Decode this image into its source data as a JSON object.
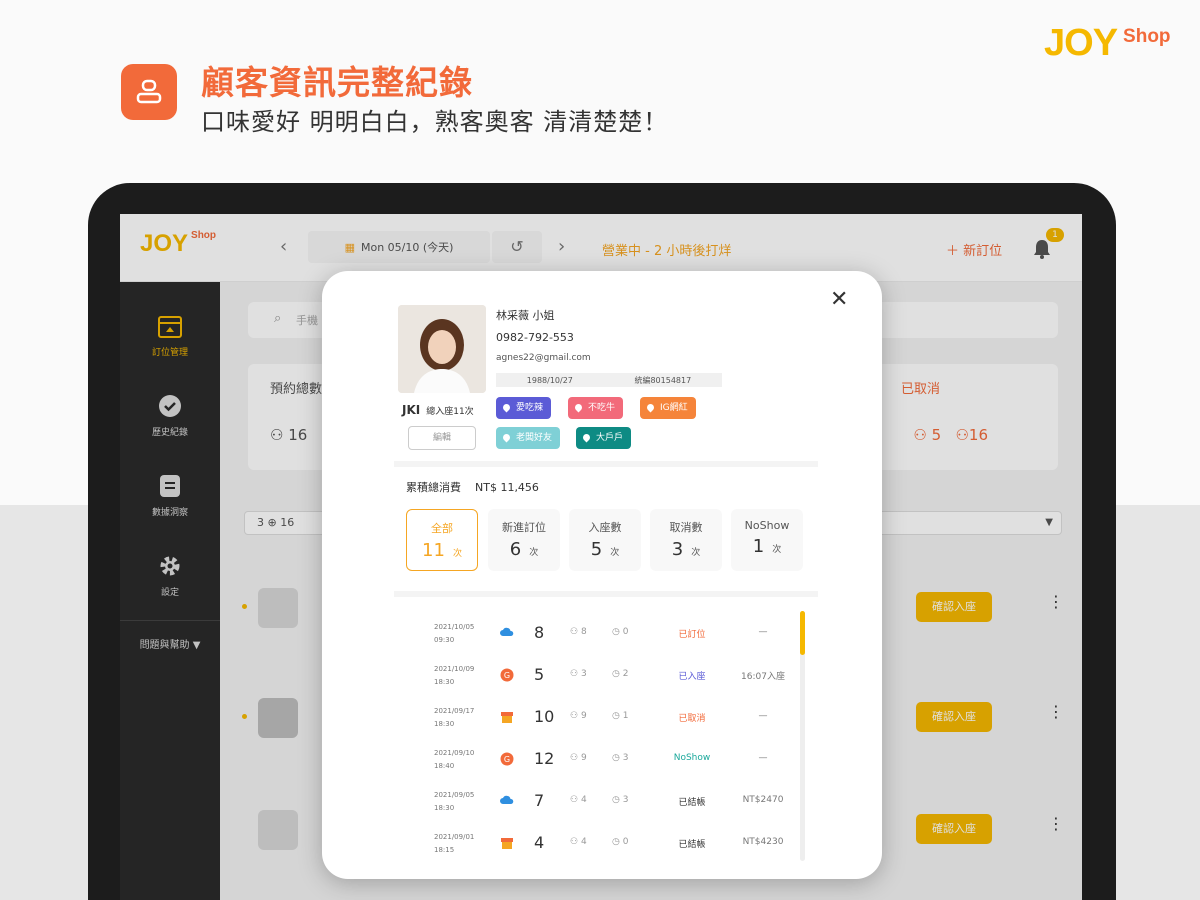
{
  "colors": {
    "accent": "#f26a3a",
    "brand_yellow": "#f5b800",
    "warn": "#f5a623"
  },
  "promo": {
    "title": "顧客資訊完整紀錄",
    "subtitle": "口味愛好 明明白白，熟客奧客 清清楚楚！"
  },
  "brand": {
    "joy": "JOY",
    "shop": "Shop"
  },
  "topbar": {
    "logo_joy": "JOY",
    "logo_shop": "Shop",
    "date": "Mon 05/10 (今天)",
    "status": "營業中 - 2 小時後打烊",
    "add_label": "新訂位",
    "bell_badge": "1"
  },
  "sidebar": {
    "items": [
      {
        "label": "訂位管理",
        "icon": "calendar-icon"
      },
      {
        "label": "歷史紀錄",
        "icon": "check-circle-icon"
      },
      {
        "label": "數據洞察",
        "icon": "list-icon"
      },
      {
        "label": "設定",
        "icon": "gear-icon"
      }
    ],
    "help": "問題與幫助"
  },
  "main": {
    "search_placeholder": "手機",
    "summary": {
      "left_label": "預約總數",
      "left_counts": "16",
      "right_label": "已取消",
      "right_counts": "5",
      "right_counts2": "16"
    },
    "filter": {
      "text": "3 ⊕ 16"
    },
    "rows": [
      {
        "action": "確認入座"
      },
      {
        "action": "確認入座"
      },
      {
        "action": "確認入座"
      }
    ]
  },
  "customer": {
    "name": "林采薇 小姐",
    "phone": "0982-792-553",
    "email": "agnes22@gmail.com",
    "birthday": "1988/10/27",
    "member_no": "統編80154817",
    "visit_count": "總入座11次",
    "visit_badge": "JKI",
    "edit_label": "編輯",
    "tags": [
      {
        "label": "愛吃辣",
        "color": "#5b5bd6"
      },
      {
        "label": "不吃牛",
        "color": "#f26a7a"
      },
      {
        "label": "IG網紅",
        "color": "#f5843a"
      },
      {
        "label": "老闆好友",
        "color": "#7fd0d6"
      },
      {
        "label": "大戶戶",
        "color": "#0e8b84"
      }
    ],
    "total_spend_label": "累積總消費",
    "total_spend_value": "NT$ 11,456",
    "stats": [
      {
        "label": "全部",
        "value": "11",
        "unit": "次",
        "active": true
      },
      {
        "label": "新進訂位",
        "value": "6",
        "unit": "次"
      },
      {
        "label": "入座數",
        "value": "5",
        "unit": "次"
      },
      {
        "label": "取消數",
        "value": "3",
        "unit": "次"
      },
      {
        "label": "NoShow",
        "value": "1",
        "unit": "次"
      }
    ],
    "history": [
      {
        "date": "2021/10/05",
        "time": "09:30",
        "source": "cloud-icon",
        "pax": "8",
        "kids": "8",
        "chairs": "0",
        "status": "已訂位",
        "status_color": "#f26a3a",
        "note": "—"
      },
      {
        "date": "2021/10/09",
        "time": "18:30",
        "source": "google-icon",
        "pax": "5",
        "kids": "3",
        "chairs": "2",
        "status": "已入座",
        "status_color": "#5b5bd6",
        "note": "16:07入座"
      },
      {
        "date": "2021/09/17",
        "time": "18:30",
        "source": "store-icon",
        "pax": "10",
        "kids": "9",
        "chairs": "1",
        "status": "已取消",
        "status_color": "#f26a3a",
        "note": "—"
      },
      {
        "date": "2021/09/10",
        "time": "18:40",
        "source": "google-icon",
        "pax": "12",
        "kids": "9",
        "chairs": "3",
        "status": "NoShow",
        "status_color": "#1aa89b",
        "note": "—"
      },
      {
        "date": "2021/09/05",
        "time": "18:30",
        "source": "cloud-icon",
        "pax": "7",
        "kids": "4",
        "chairs": "3",
        "status": "已結帳",
        "status_color": "#333333",
        "note": "NT$2470"
      },
      {
        "date": "2021/09/01",
        "time": "18:15",
        "source": "store-icon",
        "pax": "4",
        "kids": "4",
        "chairs": "0",
        "status": "已結帳",
        "status_color": "#333333",
        "note": "NT$4230"
      }
    ]
  }
}
